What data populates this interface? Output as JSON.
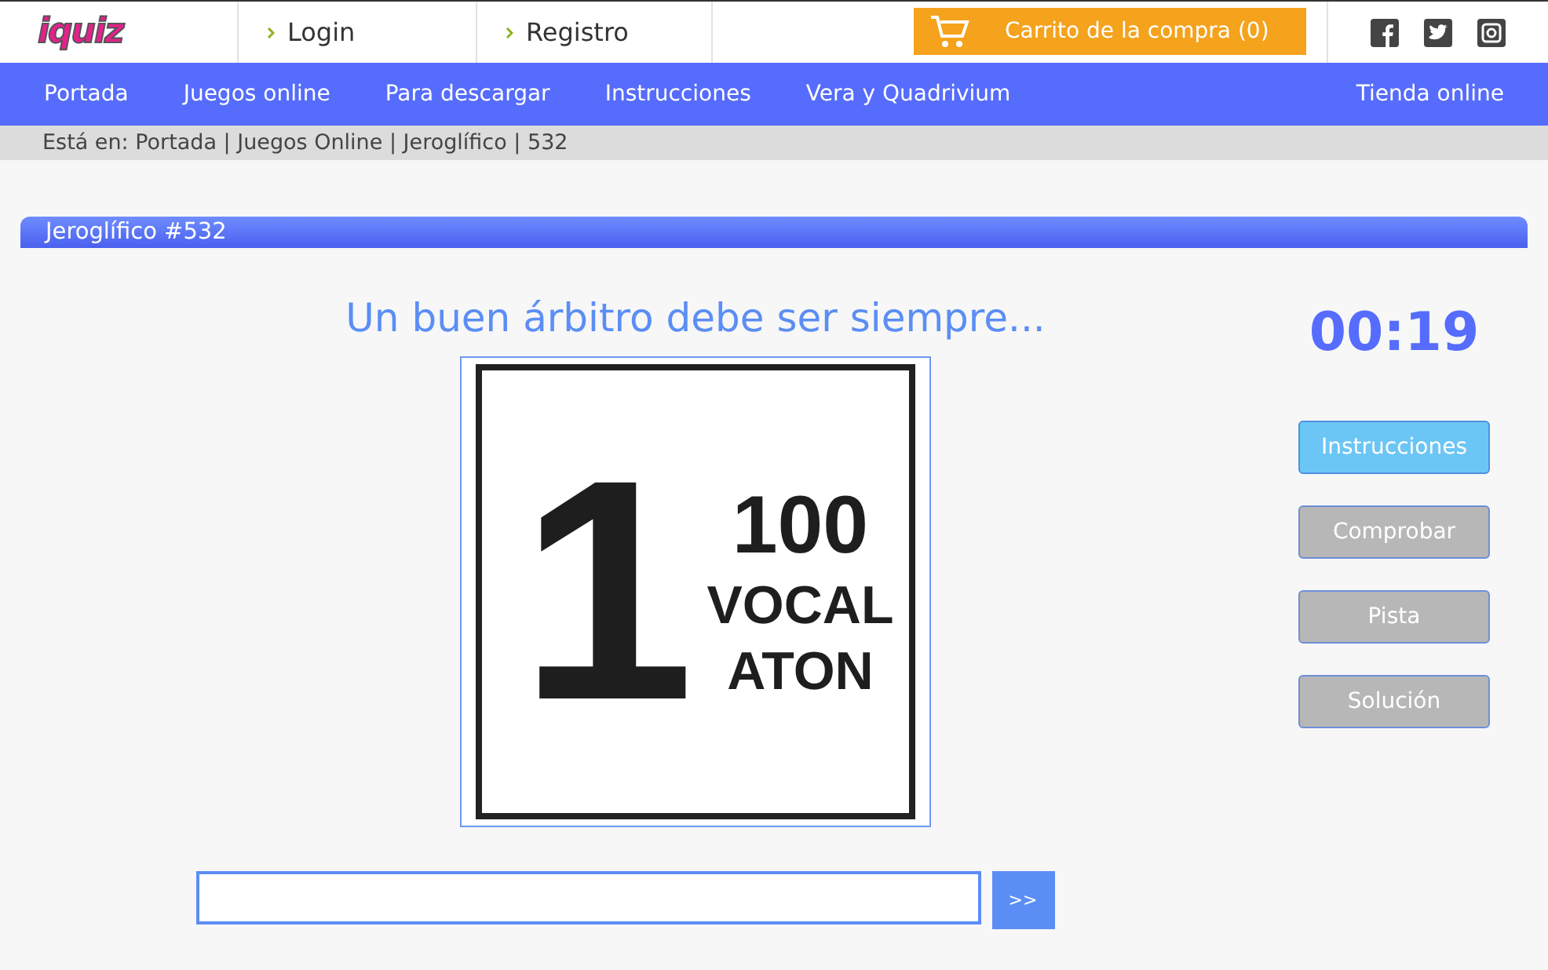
{
  "logo": "iquiz",
  "top_links": [
    "Login",
    "Registro"
  ],
  "cart": "Carrito de la compra (0)",
  "nav": [
    "Portada",
    "Juegos online",
    "Para descargar",
    "Instrucciones",
    "Vera y Quadrivium"
  ],
  "nav_right": "Tienda online",
  "breadcrumb": "Está en: Portada | Juegos Online | Jeroglífico | 532",
  "panel_title": "Jeroglífico #532",
  "question": "Un buen árbitro debe ser siempre...",
  "puzzle": {
    "big": "1",
    "lines": [
      "100",
      "VOCAL",
      "ATON"
    ]
  },
  "timer": "00:19",
  "buttons": [
    {
      "label": "Instrucciones",
      "kind": "primary"
    },
    {
      "label": "Comprobar",
      "kind": "muted"
    },
    {
      "label": "Pista",
      "kind": "muted"
    },
    {
      "label": "Solución",
      "kind": "muted"
    }
  ],
  "answer": {
    "submit": ">>"
  }
}
